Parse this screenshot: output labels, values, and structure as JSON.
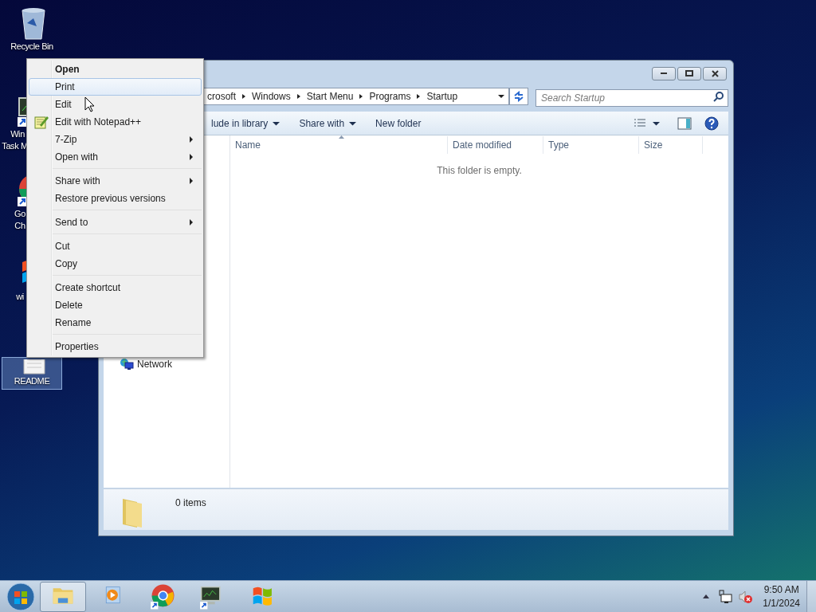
{
  "desktop_icons": [
    {
      "kind": "recycle",
      "lines": [
        "Recycle Bin"
      ],
      "selected": false
    },
    {
      "kind": "taskmgr",
      "lines": [
        "Win",
        "Task M"
      ],
      "selected": false
    },
    {
      "kind": "chrome",
      "lines": [
        "Go",
        "Ch"
      ],
      "selected": false
    },
    {
      "kind": "winlogo",
      "lines": [
        "wi"
      ],
      "selected": false
    },
    {
      "kind": "textfile",
      "lines": [
        "README"
      ],
      "selected": true
    }
  ],
  "explorer": {
    "address": [
      "crosoft",
      "Windows",
      "Start Menu",
      "Programs",
      "Startup"
    ],
    "search": {
      "placeholder": "Search Startup"
    },
    "toolbar": [
      {
        "label": "lude in library",
        "dropdown": true
      },
      {
        "label": "Share with",
        "dropdown": true
      },
      {
        "label": "New folder",
        "dropdown": false
      }
    ],
    "columns": [
      {
        "label": "Name",
        "sorted": true
      },
      {
        "label": "Date modified",
        "sorted": false
      },
      {
        "label": "Type",
        "sorted": false
      },
      {
        "label": "Size",
        "sorted": false
      }
    ],
    "empty_message": "This folder is empty.",
    "nav": [
      {
        "label": "Network"
      }
    ],
    "status": "0 items"
  },
  "context_menu": [
    {
      "kind": "item",
      "label": "Open",
      "bold": true,
      "selected": false,
      "submenu": false,
      "has_icon": false
    },
    {
      "kind": "item",
      "label": "Print",
      "bold": false,
      "selected": true,
      "submenu": false,
      "has_icon": false
    },
    {
      "kind": "item",
      "label": "Edit",
      "bold": false,
      "selected": false,
      "submenu": false,
      "has_icon": false
    },
    {
      "kind": "item",
      "label": "Edit with Notepad++",
      "bold": false,
      "selected": false,
      "submenu": false,
      "has_icon": true
    },
    {
      "kind": "item",
      "label": "7-Zip",
      "bold": false,
      "selected": false,
      "submenu": true,
      "has_icon": false
    },
    {
      "kind": "item",
      "label": "Open with",
      "bold": false,
      "selected": false,
      "submenu": true,
      "has_icon": false
    },
    {
      "kind": "separator"
    },
    {
      "kind": "item",
      "label": "Share with",
      "bold": false,
      "selected": false,
      "submenu": true,
      "has_icon": false
    },
    {
      "kind": "item",
      "label": "Restore previous versions",
      "bold": false,
      "selected": false,
      "submenu": false,
      "has_icon": false
    },
    {
      "kind": "separator"
    },
    {
      "kind": "item",
      "label": "Send to",
      "bold": false,
      "selected": false,
      "submenu": true,
      "has_icon": false
    },
    {
      "kind": "separator"
    },
    {
      "kind": "item",
      "label": "Cut",
      "bold": false,
      "selected": false,
      "submenu": false,
      "has_icon": false
    },
    {
      "kind": "item",
      "label": "Copy",
      "bold": false,
      "selected": false,
      "submenu": false,
      "has_icon": false
    },
    {
      "kind": "separator"
    },
    {
      "kind": "item",
      "label": "Create shortcut",
      "bold": false,
      "selected": false,
      "submenu": false,
      "has_icon": false
    },
    {
      "kind": "item",
      "label": "Delete",
      "bold": false,
      "selected": false,
      "submenu": false,
      "has_icon": false
    },
    {
      "kind": "item",
      "label": "Rename",
      "bold": false,
      "selected": false,
      "submenu": false,
      "has_icon": false
    },
    {
      "kind": "separator"
    },
    {
      "kind": "item",
      "label": "Properties",
      "bold": false,
      "selected": false,
      "submenu": false,
      "has_icon": false
    }
  ],
  "taskbar": {
    "apps": [
      {
        "kind": "explorer",
        "active": true
      },
      {
        "kind": "media",
        "active": false
      },
      {
        "kind": "chrome",
        "active": false
      },
      {
        "kind": "taskmgr",
        "active": false
      },
      {
        "kind": "winlogo",
        "active": false
      }
    ],
    "time": "9:50 AM",
    "date": "1/1/2024"
  }
}
